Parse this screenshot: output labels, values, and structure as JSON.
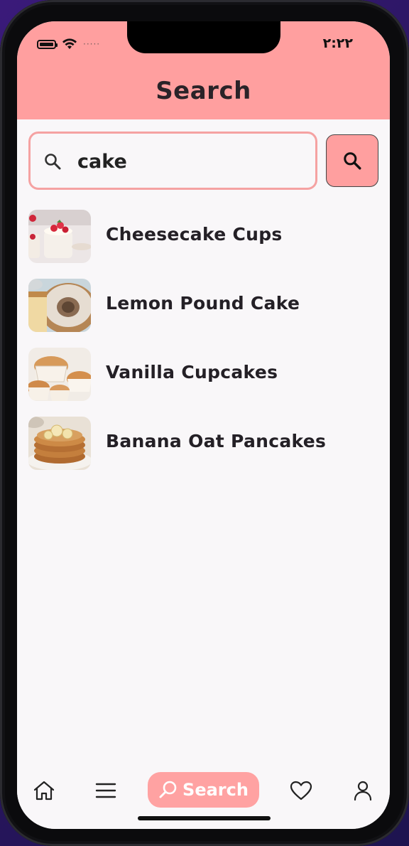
{
  "status_bar": {
    "time": "٢:٢٢",
    "carrier": "·····"
  },
  "header": {
    "title": "Search"
  },
  "search": {
    "value": "cake",
    "placeholder": ""
  },
  "results": [
    {
      "label": "Cheesecake Cups",
      "thumbnail": "cheesecake-cups-photo"
    },
    {
      "label": "Lemon Pound Cake",
      "thumbnail": "lemon-pound-cake-photo"
    },
    {
      "label": "Vanilla Cupcakes",
      "thumbnail": "vanilla-cupcakes-photo"
    },
    {
      "label": "Banana Oat Pancakes",
      "thumbnail": "banana-oat-pancakes-photo"
    }
  ],
  "bottom_nav": {
    "items": [
      {
        "name": "home",
        "icon": "home-icon"
      },
      {
        "name": "menu",
        "icon": "menu-icon"
      },
      {
        "name": "search",
        "icon": "search-icon",
        "label": "Search",
        "active": true
      },
      {
        "name": "favorites",
        "icon": "heart-icon"
      },
      {
        "name": "profile",
        "icon": "user-icon"
      }
    ]
  },
  "colors": {
    "accent": "#ff9f9f",
    "field_border": "#f5a2a2",
    "background": "#f9f7f9",
    "text": "#242026"
  }
}
